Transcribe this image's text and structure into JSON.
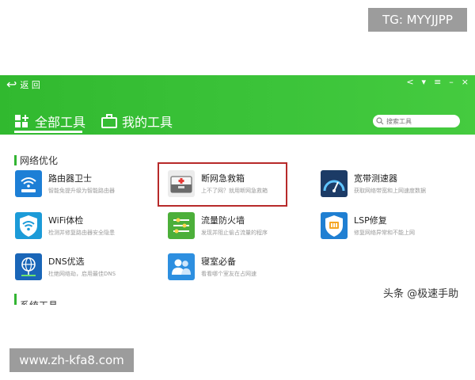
{
  "watermark_top": "TG: MYYJJPP",
  "watermark_bottom": "www.zh-kfa8.com",
  "header": {
    "back_label": "返 回",
    "tabs": [
      {
        "label": "全部工具"
      },
      {
        "label": "我的工具"
      }
    ],
    "search_placeholder": "搜索工具"
  },
  "sections": {
    "network": {
      "title": "网络优化"
    },
    "system": {
      "title": "系统工具"
    }
  },
  "tools": [
    {
      "name": "路由器卫士",
      "desc": "智能免提升级为智能路由器",
      "icon": "wifi-router-icon",
      "color": "#1d7fd6"
    },
    {
      "name": "断网急救箱",
      "desc": "上不了网？就用断网急救箱",
      "icon": "first-aid-kit-icon",
      "color": "#e9e9e9"
    },
    {
      "name": "宽带测速器",
      "desc": "获取网络带宽和上网速度数据",
      "icon": "speedometer-icon",
      "color": "#1c3b66"
    },
    {
      "name": "WiFi体检",
      "desc": "检测并修复路由器安全隐患",
      "icon": "wifi-shield-icon",
      "color": "#1c9bd8"
    },
    {
      "name": "流量防火墙",
      "desc": "发现并阻止偷占流量的程序",
      "icon": "firewall-icon",
      "color": "#4caf3a"
    },
    {
      "name": "LSP修复",
      "desc": "修复网络异常和不能上网",
      "icon": "lsp-repair-icon",
      "color": "#1f7fd2"
    },
    {
      "name": "DNS优选",
      "desc": "杜绝网络劫，启用最佳DNS",
      "icon": "dns-globe-icon",
      "color": "#1a66b8"
    },
    {
      "name": "寝室必备",
      "desc": "看看哪个室友在占网速",
      "icon": "dorm-users-icon",
      "color": "#2d8fe0"
    }
  ],
  "caption": "头条 @极速手助"
}
